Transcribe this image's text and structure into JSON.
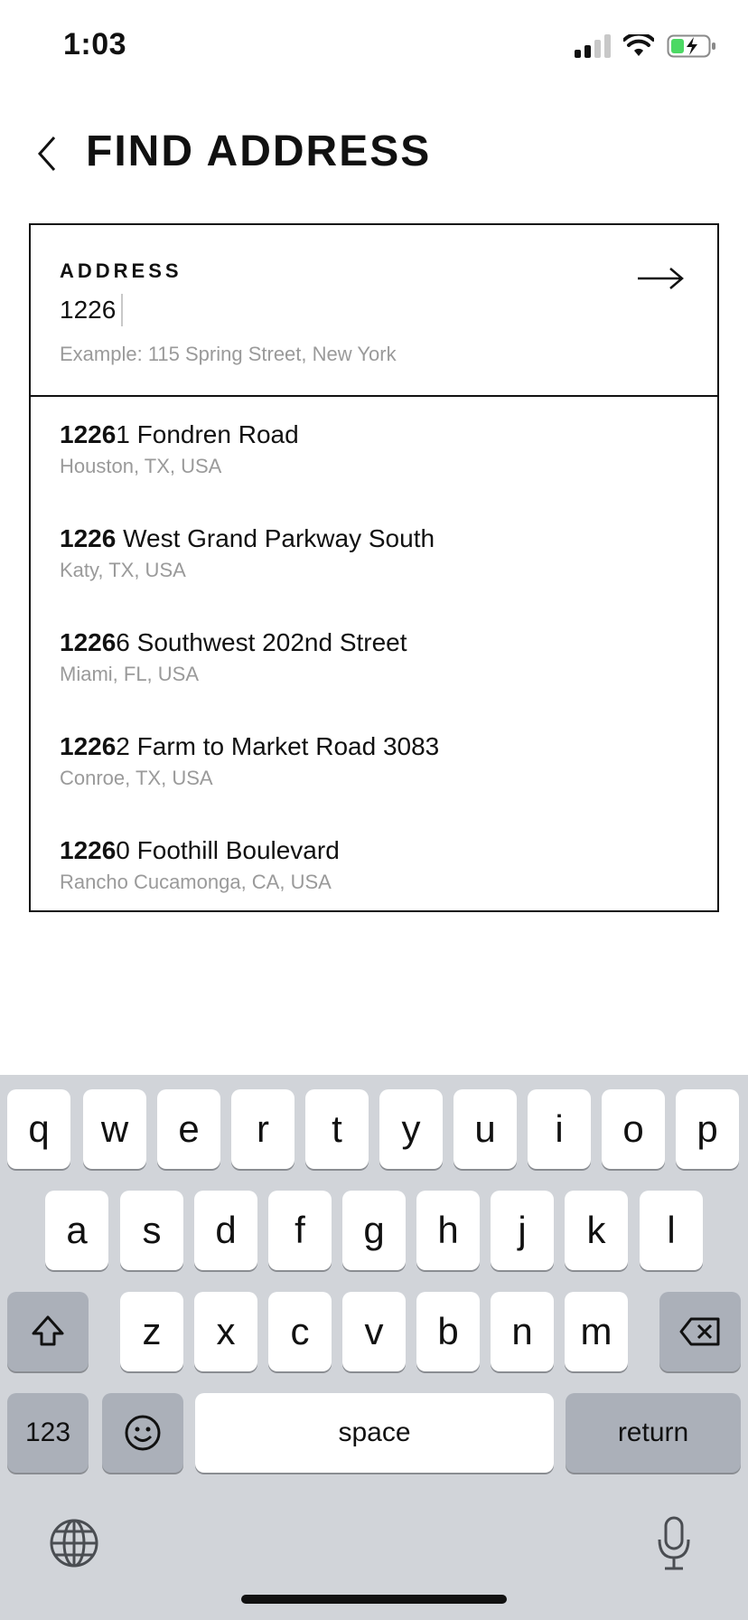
{
  "status_bar": {
    "time": "1:03"
  },
  "header": {
    "title": "FIND ADDRESS"
  },
  "address_field": {
    "label": "ADDRESS",
    "value": "1226",
    "hint": "Example: 115 Spring Street, New York"
  },
  "results": [
    {
      "match": "1226",
      "rest": "1 Fondren Road",
      "subtitle": "Houston, TX, USA"
    },
    {
      "match": "1226",
      "rest": " West Grand Parkway South",
      "subtitle": "Katy, TX, USA"
    },
    {
      "match": "1226",
      "rest": "6 Southwest 202nd Street",
      "subtitle": "Miami, FL, USA"
    },
    {
      "match": "1226",
      "rest": "2 Farm to Market Road 3083",
      "subtitle": "Conroe, TX, USA"
    },
    {
      "match": "1226",
      "rest": "0 Foothill Boulevard",
      "subtitle": "Rancho Cucamonga, CA, USA"
    }
  ],
  "keyboard": {
    "row1": [
      "q",
      "w",
      "e",
      "r",
      "t",
      "y",
      "u",
      "i",
      "o",
      "p"
    ],
    "row2": [
      "a",
      "s",
      "d",
      "f",
      "g",
      "h",
      "j",
      "k",
      "l"
    ],
    "row3": [
      "z",
      "x",
      "c",
      "v",
      "b",
      "n",
      "m"
    ],
    "numbers_label": "123",
    "space_label": "space",
    "return_label": "return"
  },
  "colors": {
    "battery": "#4cd964",
    "accent": "#111111",
    "hint": "#9a9a9a"
  }
}
